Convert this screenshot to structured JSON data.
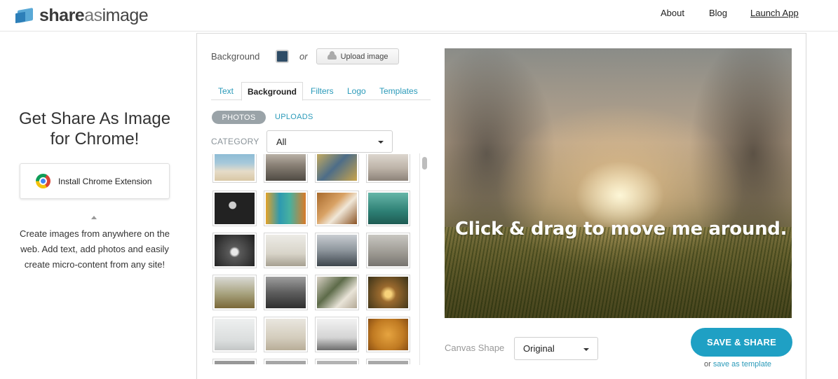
{
  "header": {
    "logo_bold": "share",
    "logo_mid": "as",
    "logo_end": "image",
    "nav": {
      "about": "About",
      "blog": "Blog",
      "launch_app": "Launch App"
    }
  },
  "promo": {
    "title_line1": "Get Share As Image",
    "title_line2": "for Chrome!",
    "chrome_button": "Install Chrome Extension",
    "description": "Create images from anywhere on the web. Add text, add photos and easily create micro-content from any site!"
  },
  "editor": {
    "background_label": "Background",
    "background_color": "#2e4c66",
    "or_label": "or",
    "upload_button": "Upload image",
    "tabs": [
      "Text",
      "Background",
      "Filters",
      "Logo",
      "Templates"
    ],
    "active_tab": "Background",
    "source_tabs": {
      "photos": "PHOTOS",
      "uploads": "UPLOADS"
    },
    "category_label": "CATEGORY",
    "category_value": "All",
    "canvas_text": "Click & drag to move me around.",
    "canvas_shape_label": "Canvas Shape",
    "canvas_shape_value": "Original",
    "save_button": "SAVE & SHARE",
    "save_sub_or": "or",
    "save_template_link": "save as template",
    "accent_color": "#1fa0c4"
  },
  "thumbnails": [
    {
      "name": "beach-photo",
      "bg": "linear-gradient(180deg,#7fb5d3 0%,#a8c9da 45%,#e6dcc8 70%,#d9c7a5 100%)"
    },
    {
      "name": "pier-photo",
      "bg": "linear-gradient(180deg,#cfc7bd 0%,#8a8176 50%,#4f4a43 100%)"
    },
    {
      "name": "shoes-photo",
      "bg": "linear-gradient(135deg,#d6b45a 0%,#4d6d88 50%,#c9a44b 100%)"
    },
    {
      "name": "bicycle-photo",
      "bg": "linear-gradient(180deg,#e8e3dc 0%,#bdb3a8 60%,#8d8379 100%)"
    },
    {
      "name": "sign-photo",
      "bg": "radial-gradient(circle at 45% 40%,#cfcfcf 0 12%,#222 14% 100%)"
    },
    {
      "name": "canal-photo",
      "bg": "linear-gradient(90deg,#e3a32b 0%,#2e9ab0 35%,#47b0a0 60%,#d97b2a 100%)"
    },
    {
      "name": "desk-photo",
      "bg": "linear-gradient(135deg,#a86a2c 0%,#d9a265 40%,#f0e7d8 60%,#8b5425 100%)"
    },
    {
      "name": "teal-wall-photo",
      "bg": "linear-gradient(180deg,#66b6a8 0%,#2d7f74 60%,#1e5b53 100%)"
    },
    {
      "name": "lights-photo",
      "bg": "radial-gradient(circle at 50% 55%,#e8e8e8 0 12%,#5a5a5a 20%,#1e1e1e 100%)"
    },
    {
      "name": "shelf-photo",
      "bg": "linear-gradient(180deg,#ecebe6 0%,#d8d4c9 60%,#a6a091 100%)"
    },
    {
      "name": "mountain-photo",
      "bg": "linear-gradient(180deg,#c9cdd2 0%,#8d959c 50%,#3e464d 100%)"
    },
    {
      "name": "surfer-photo",
      "bg": "linear-gradient(180deg,#c8c6c1 0%,#9b9891 60%,#777470 100%)"
    },
    {
      "name": "hills-photo",
      "bg": "linear-gradient(180deg,#dadad6 0%,#a6a17c 55%,#7a6838 100%)"
    },
    {
      "name": "road-photo",
      "bg": "linear-gradient(180deg,#9e9e9e 0%,#5e5e5e 50%,#2f2f2f 100%)"
    },
    {
      "name": "plant-photo",
      "bg": "linear-gradient(135deg,#d9d2c6 0%,#5d6b49 40%,#e9e4d8 70%,#b3a896 100%)"
    },
    {
      "name": "sunset-trees-photo",
      "bg": "radial-gradient(circle at 50% 55%,#f7d27a 0 12%,#9b6a2e 30%,#3a3218 100%)"
    },
    {
      "name": "fog-photo",
      "bg": "linear-gradient(180deg,#eef0f0 0%,#dadddd 70%,#c3c6c6 100%)"
    },
    {
      "name": "traveler-photo",
      "bg": "linear-gradient(180deg,#e9e6df 0%,#d4cdbd 60%,#b8ad98 100%)"
    },
    {
      "name": "cloud-peak-photo",
      "bg": "linear-gradient(180deg,#f2f2f2 0%,#d4d4d4 60%,#6d6d6d 100%)"
    },
    {
      "name": "orange-texture-photo",
      "bg": "radial-gradient(circle at 50% 50%,#e6a440 0%,#c07a22 60%,#8a4f14 100%)"
    },
    {
      "name": "partial-photo-1",
      "bg": "linear-gradient(180deg,#9a9a9a,#7b7b7b)"
    },
    {
      "name": "partial-photo-2",
      "bg": "linear-gradient(180deg,#a8a8a8,#888)"
    },
    {
      "name": "partial-photo-3",
      "bg": "linear-gradient(180deg,#b5b5b5,#949494)"
    },
    {
      "name": "partial-photo-4",
      "bg": "linear-gradient(180deg,#aaa,#8c8c8c)"
    }
  ]
}
